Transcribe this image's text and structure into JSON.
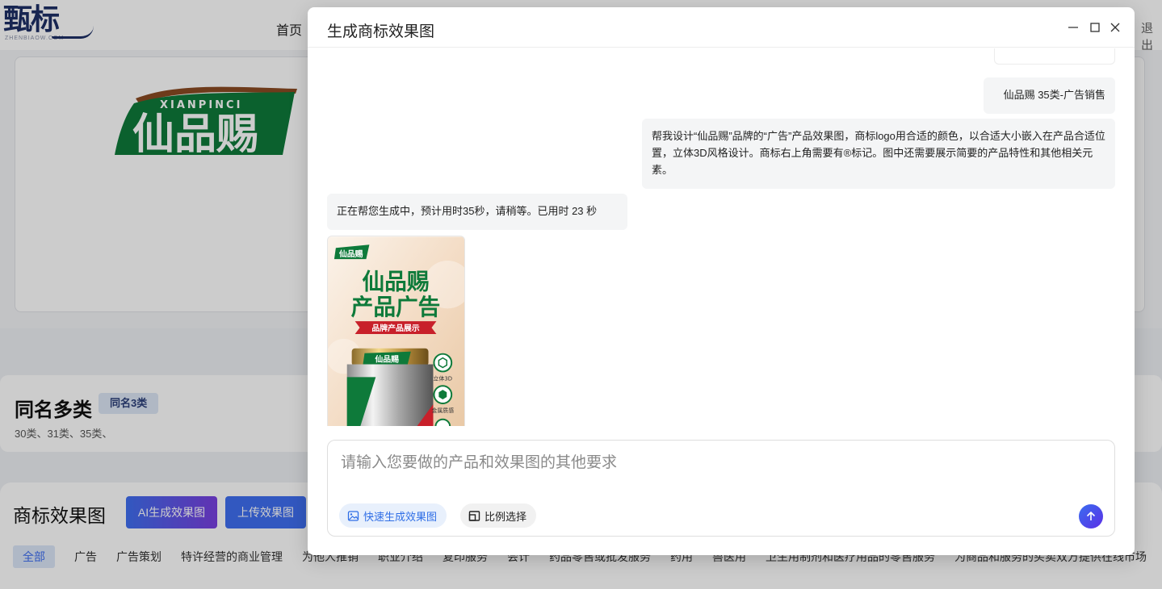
{
  "site": {
    "logo_text": "甄标",
    "logo_sub": "ZHENBIAOW.COM",
    "nav_home": "首页",
    "nav_logout": "退出"
  },
  "brand_logo": {
    "pinyin": "XIANPINCI",
    "name": "仙品赐"
  },
  "same_name": {
    "title": "同名多类",
    "badge": "同名3类",
    "classes": "30类、31类、35类、"
  },
  "effects": {
    "title": "商标效果图",
    "ai_button": "AI生成效果图",
    "upload_button": "上传效果图",
    "categories": [
      "全部",
      "广告",
      "广告策划",
      "特许经营的商业管理",
      "为他人推销",
      "职业介绍",
      "复印服务",
      "会计",
      "药品零售或批发服务",
      "药用",
      "兽医用",
      "卫生用制剂和医疗用品的零售服务",
      "为商品和服务的买卖双方提供在线市场"
    ]
  },
  "modal": {
    "title": "生成商标效果图",
    "messages": {
      "brand": "仙品赐 35类-广告销售",
      "request": "帮我设计“仙品赐”品牌的“广告”产品效果图，商标logo用合适的颜色，以合适大小嵌入在产品合适位置，立体3D风格设计。商标右上角需要有®标记。图中还需要展示简要的产品特性和其他相关元素。",
      "progress": "正在帮您生成中，预计用时35秒，请稍等。已用时 23 秒"
    },
    "poster": {
      "logo": "仙品赐",
      "line1": "仙品赐",
      "line2": "产品广告",
      "ribbon": "品牌产品展示",
      "can_logo": "仙品赐",
      "feature1": "立体3D",
      "feature2": "金属质感"
    },
    "input": {
      "placeholder": "请输入您要做的产品和效果图的其他要求",
      "value": ""
    },
    "chips": {
      "quick": "快速生成效果图",
      "ratio": "比例选择"
    }
  },
  "colors": {
    "brand_green": "#0e7a3a",
    "accent_blue": "#3f6ff0",
    "ribbon_red": "#c8202a"
  }
}
